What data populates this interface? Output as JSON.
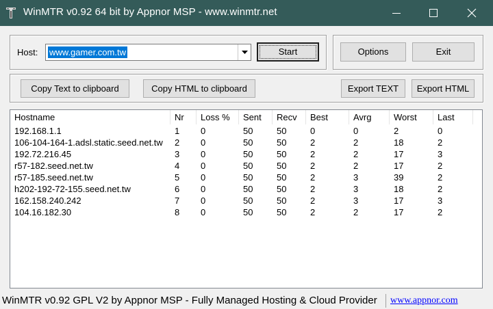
{
  "window": {
    "title": "WinMTR v0.92 64 bit by Appnor MSP - www.winmtr.net"
  },
  "host": {
    "label": "Host:",
    "value": "www.gamer.com.tw"
  },
  "buttons": {
    "start": "Start",
    "options": "Options",
    "exit": "Exit",
    "copy_text": "Copy Text to clipboard",
    "copy_html": "Copy HTML to clipboard",
    "export_text": "Export TEXT",
    "export_html": "Export HTML"
  },
  "table": {
    "columns": [
      "Hostname",
      "Nr",
      "Loss %",
      "Sent",
      "Recv",
      "Best",
      "Avrg",
      "Worst",
      "Last"
    ],
    "rows": [
      [
        "192.168.1.1",
        "1",
        "0",
        "50",
        "50",
        "0",
        "0",
        "2",
        "0"
      ],
      [
        "106-104-164-1.adsl.static.seed.net.tw",
        "2",
        "0",
        "50",
        "50",
        "2",
        "2",
        "18",
        "2"
      ],
      [
        "192.72.216.45",
        "3",
        "0",
        "50",
        "50",
        "2",
        "2",
        "17",
        "3"
      ],
      [
        "r57-182.seed.net.tw",
        "4",
        "0",
        "50",
        "50",
        "2",
        "2",
        "17",
        "2"
      ],
      [
        "r57-185.seed.net.tw",
        "5",
        "0",
        "50",
        "50",
        "2",
        "3",
        "39",
        "2"
      ],
      [
        "h202-192-72-155.seed.net.tw",
        "6",
        "0",
        "50",
        "50",
        "2",
        "3",
        "18",
        "2"
      ],
      [
        "162.158.240.242",
        "7",
        "0",
        "50",
        "50",
        "2",
        "3",
        "17",
        "3"
      ],
      [
        "104.16.182.30",
        "8",
        "0",
        "50",
        "50",
        "2",
        "2",
        "17",
        "2"
      ]
    ]
  },
  "status": {
    "text": "WinMTR v0.92 GPL V2 by Appnor MSP - Fully Managed Hosting & Cloud Provider",
    "link": "www.appnor.com"
  },
  "colors": {
    "titlebar": "#345b59",
    "selection": "#0078d7",
    "link": "#0000ff"
  }
}
